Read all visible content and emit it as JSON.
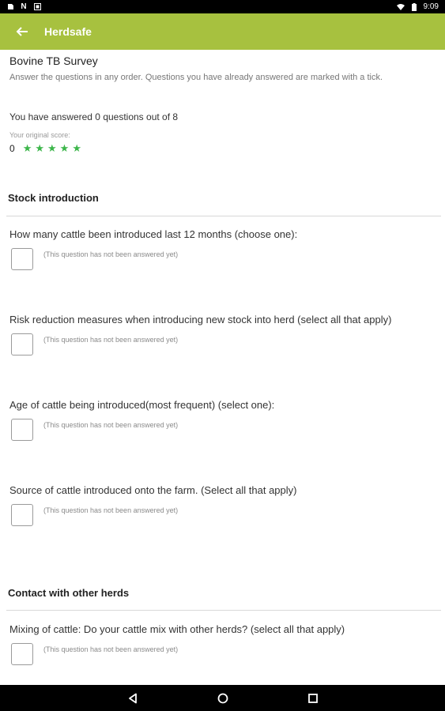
{
  "status_bar": {
    "time": "9:09",
    "icons": [
      "notification-icon",
      "n-icon",
      "photo-icon",
      "wifi-icon",
      "battery-icon"
    ]
  },
  "app_bar": {
    "title": "Herdsafe",
    "back_icon": "arrow-left-icon",
    "color": "#a7c13f"
  },
  "survey": {
    "title": "Bovine TB Survey",
    "description": "Answer the questions in any order. Questions you have already answered are marked with a tick.",
    "answered_text": "You have answered 0 questions out of 8",
    "score_label": "Your original score:",
    "score_value": "0",
    "stars": 5,
    "star_color": "#3cb64a"
  },
  "sections": [
    {
      "title": "Stock introduction",
      "questions": [
        {
          "text": "How many cattle been introduced last 12 months (choose one):",
          "status": "(This question has not been answered yet)"
        },
        {
          "text": "Risk reduction measures when introducing new stock into herd (select all that apply)",
          "status": "(This question has not been answered yet)"
        },
        {
          "text": "Age of cattle being introduced(most frequent) (select one):",
          "status": "(This question has not been answered yet)"
        },
        {
          "text": "Source of cattle introduced onto the farm. (Select all that apply)",
          "status": "(This question has not been answered yet)"
        }
      ]
    },
    {
      "title": "Contact with other herds",
      "questions": [
        {
          "text": "Mixing of cattle: Do your cattle mix with other herds? (select all that apply)",
          "status": "(This question has not been answered yet)"
        }
      ]
    }
  ],
  "nav_bar": {
    "buttons": [
      "back-triangle-icon",
      "home-circle-icon",
      "recents-square-icon"
    ]
  }
}
